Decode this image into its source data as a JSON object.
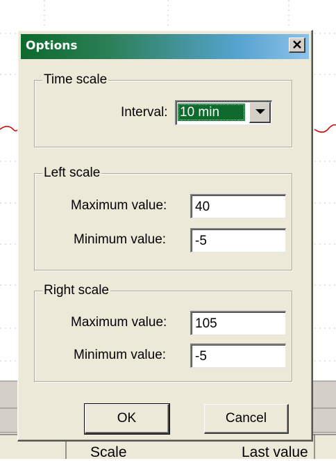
{
  "background": {
    "table_headers": [
      "Scale",
      "Last value"
    ]
  },
  "dialog": {
    "title": "Options",
    "close_symbol": "close-x-icon",
    "time_scale": {
      "title": "Time scale",
      "interval_label": "Interval:",
      "interval_value": "10 min"
    },
    "left_scale": {
      "title": "Left scale",
      "max_label": "Maximum value:",
      "max_value": "40",
      "min_label": "Minimum value:",
      "min_value": "-5"
    },
    "right_scale": {
      "title": "Right scale",
      "max_label": "Maximum value:",
      "max_value": "105",
      "min_label": "Minimum value:",
      "min_value": "-5"
    },
    "buttons": {
      "ok": "OK",
      "cancel": "Cancel"
    }
  },
  "colors": {
    "title_gradient_start": "#0d6a2c",
    "title_gradient_end": "#8cc2ea",
    "dialog_face": "#ece9d8",
    "selection": "#0d6a2c",
    "chart_trace": "#cc0000"
  }
}
